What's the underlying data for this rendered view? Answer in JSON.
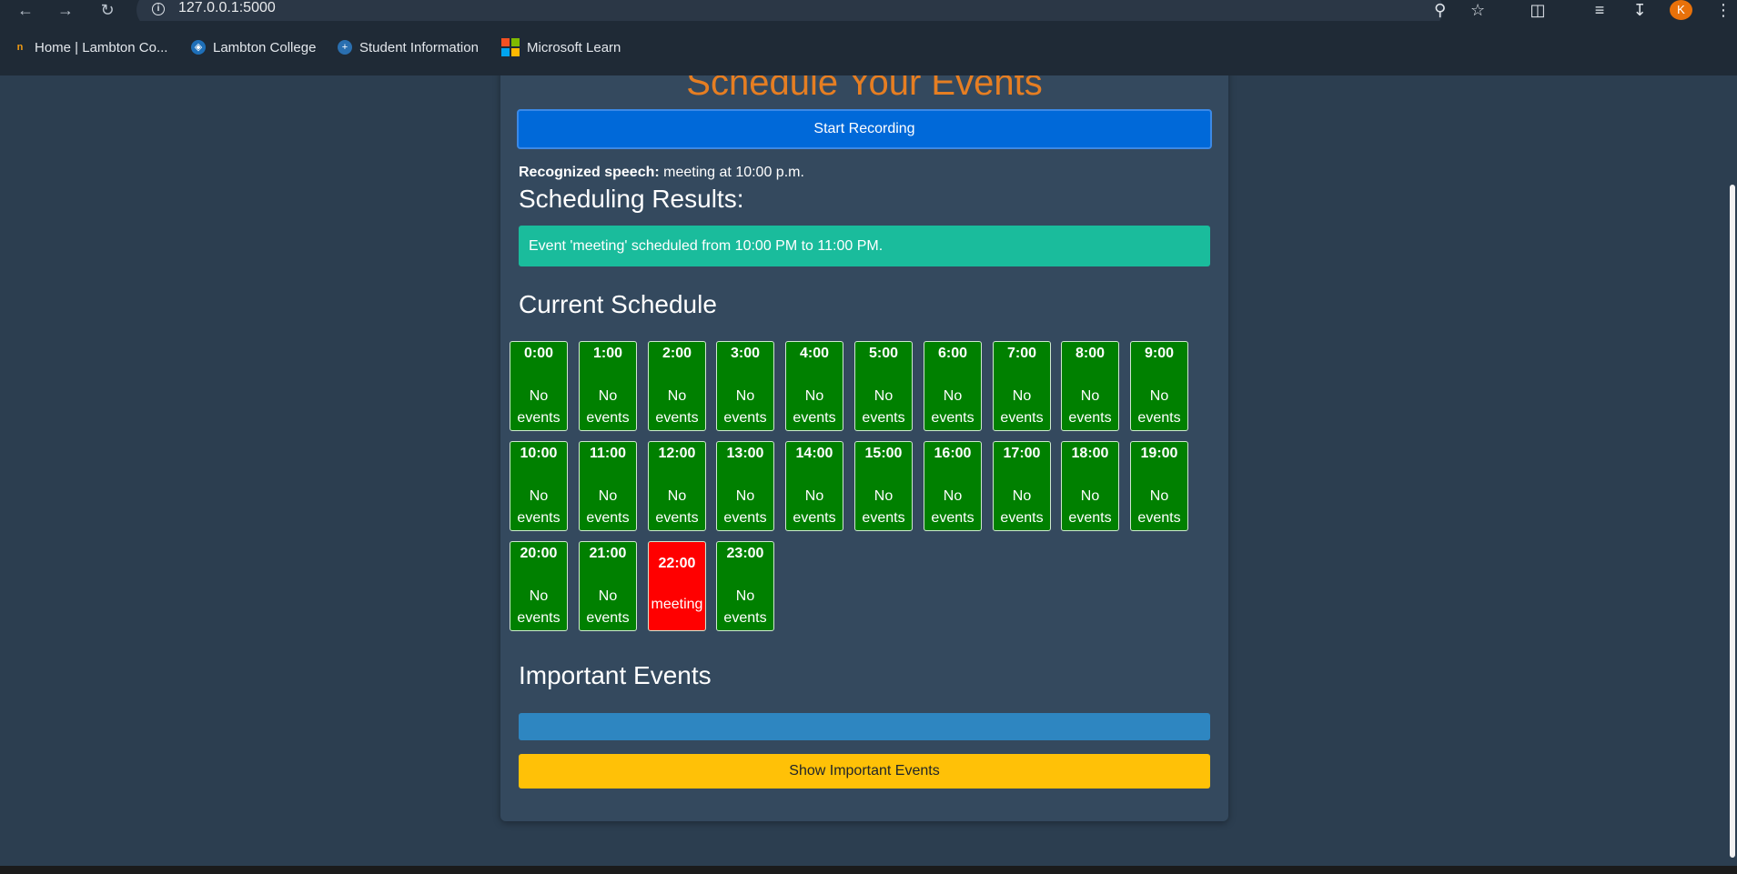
{
  "browser": {
    "url": "127.0.0.1:5000",
    "profile_initial": "K",
    "bookmarks": [
      {
        "label": "Home | Lambton Co..."
      },
      {
        "label": "Lambton College"
      },
      {
        "label": "Student Information"
      },
      {
        "label": "Microsoft Learn"
      }
    ]
  },
  "page": {
    "title": "Schedule Your Events",
    "record_button": "Start Recording",
    "speech_label": "Recognized speech:",
    "speech_text": "meeting at 10:00 p.m.",
    "results_heading": "Scheduling Results:",
    "result_message": "Event 'meeting' scheduled from 10:00 PM to 11:00 PM.",
    "schedule_heading": "Current Schedule",
    "important_heading": "Important Events",
    "show_important_button": "Show Important Events"
  },
  "schedule": [
    {
      "hour": "0:00",
      "event": "No events",
      "busy": false
    },
    {
      "hour": "1:00",
      "event": "No events",
      "busy": false
    },
    {
      "hour": "2:00",
      "event": "No events",
      "busy": false
    },
    {
      "hour": "3:00",
      "event": "No events",
      "busy": false
    },
    {
      "hour": "4:00",
      "event": "No events",
      "busy": false
    },
    {
      "hour": "5:00",
      "event": "No events",
      "busy": false
    },
    {
      "hour": "6:00",
      "event": "No events",
      "busy": false
    },
    {
      "hour": "7:00",
      "event": "No events",
      "busy": false
    },
    {
      "hour": "8:00",
      "event": "No events",
      "busy": false
    },
    {
      "hour": "9:00",
      "event": "No events",
      "busy": false
    },
    {
      "hour": "10:00",
      "event": "No events",
      "busy": false
    },
    {
      "hour": "11:00",
      "event": "No events",
      "busy": false
    },
    {
      "hour": "12:00",
      "event": "No events",
      "busy": false
    },
    {
      "hour": "13:00",
      "event": "No events",
      "busy": false
    },
    {
      "hour": "14:00",
      "event": "No events",
      "busy": false
    },
    {
      "hour": "15:00",
      "event": "No events",
      "busy": false
    },
    {
      "hour": "16:00",
      "event": "No events",
      "busy": false
    },
    {
      "hour": "17:00",
      "event": "No events",
      "busy": false
    },
    {
      "hour": "18:00",
      "event": "No events",
      "busy": false
    },
    {
      "hour": "19:00",
      "event": "No events",
      "busy": false
    },
    {
      "hour": "20:00",
      "event": "No events",
      "busy": false
    },
    {
      "hour": "21:00",
      "event": "No events",
      "busy": false
    },
    {
      "hour": "22:00",
      "event": "meeting",
      "busy": true
    },
    {
      "hour": "23:00",
      "event": "No events",
      "busy": false
    }
  ],
  "colors": {
    "free_slot": "#008000",
    "busy_slot": "#ff0000",
    "title": "#e67e22",
    "result_bg": "#1abc9c",
    "important_bg": "#2e86c1",
    "show_button_bg": "#ffc107"
  }
}
